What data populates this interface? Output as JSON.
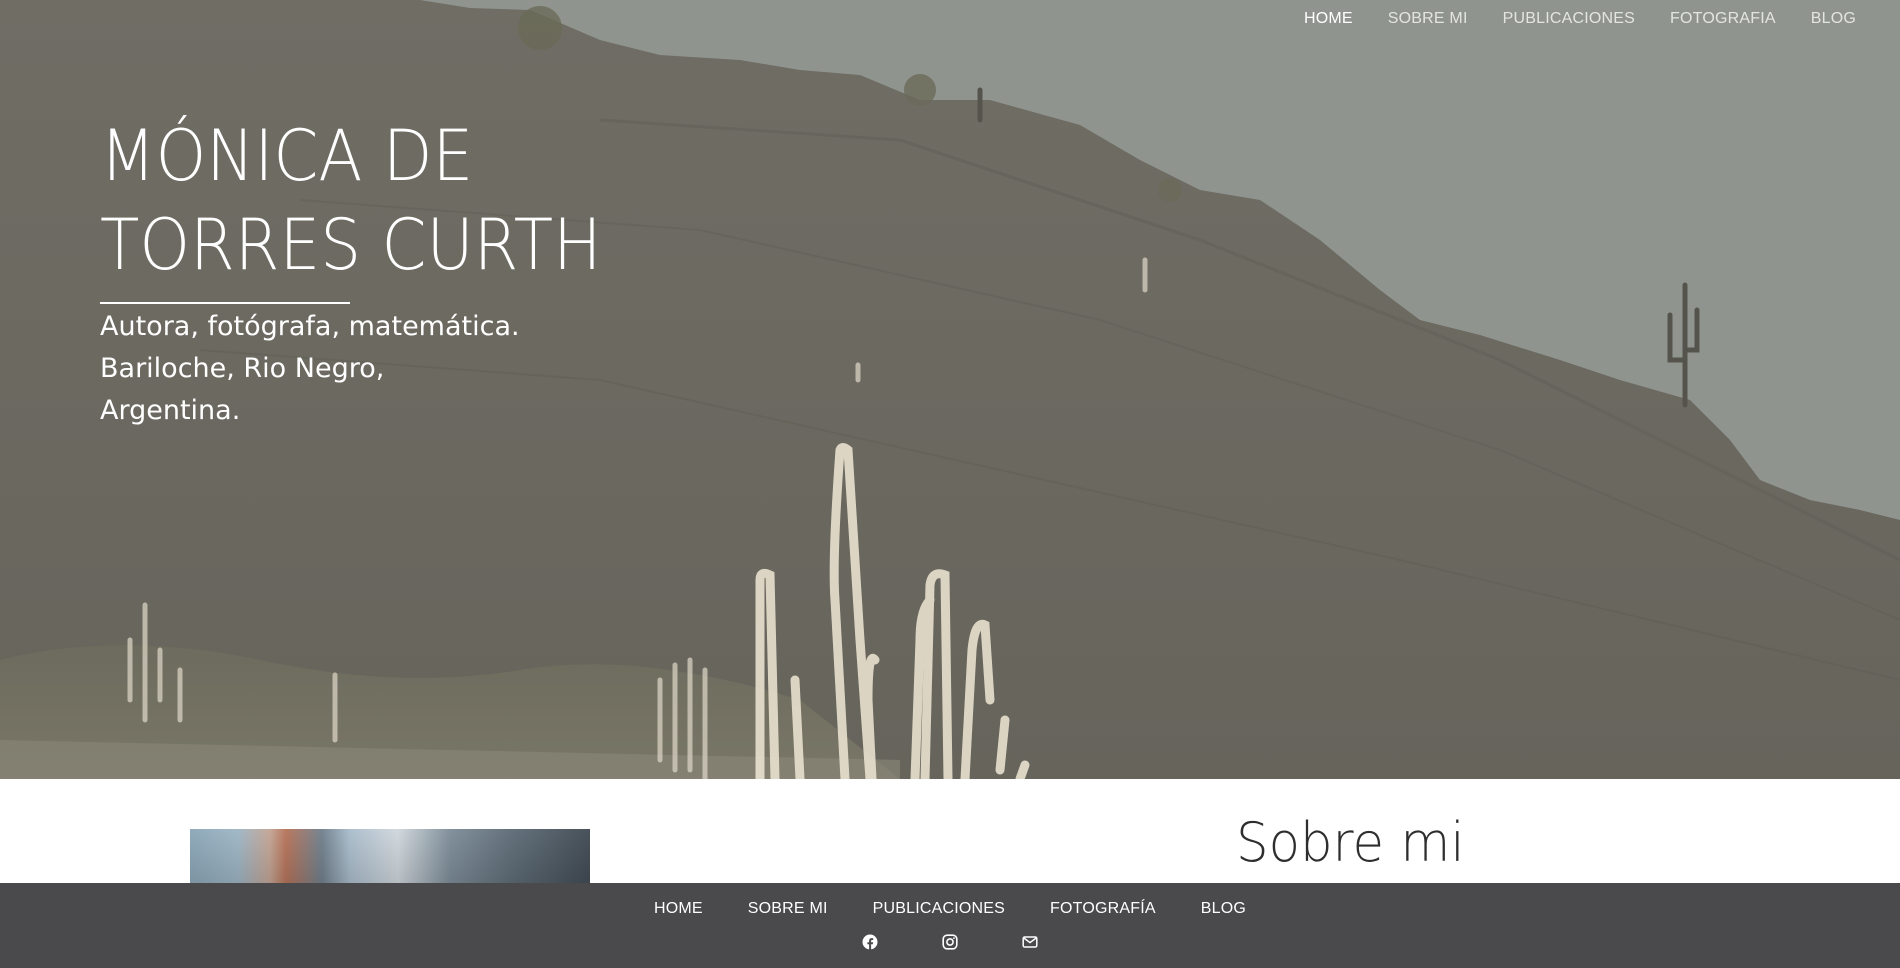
{
  "nav": {
    "items": [
      {
        "label": "HOME",
        "active": true
      },
      {
        "label": "SOBRE MI",
        "active": false
      },
      {
        "label": "PUBLICACIONES",
        "active": false
      },
      {
        "label": "FOTOGRAFIA",
        "active": false
      },
      {
        "label": "BLOG",
        "active": false
      }
    ]
  },
  "hero": {
    "title_line1": "MÓNICA DE",
    "title_line2": "TORRES CURTH",
    "subtitle_line1": "Autora, fotógrafa, matemática.",
    "subtitle_line2": "Bariloche, Rio Negro,",
    "subtitle_line3": "Argentina.",
    "image": "desert-hillside-with-cacti"
  },
  "about": {
    "title": "Sobre mi",
    "photo": "profile-photo"
  },
  "footer": {
    "nav": [
      {
        "label": "HOME"
      },
      {
        "label": "SOBRE MI"
      },
      {
        "label": "PUBLICACIONES"
      },
      {
        "label": "FOTOGRAFÍA"
      },
      {
        "label": "BLOG"
      }
    ],
    "icons": [
      "facebook-icon",
      "instagram-icon",
      "email-icon"
    ]
  },
  "colors": {
    "footer_bg": "#4a494b",
    "hero_sky": "#8e948d",
    "hero_hill": "#6b6a61",
    "text_light": "#ffffff"
  }
}
